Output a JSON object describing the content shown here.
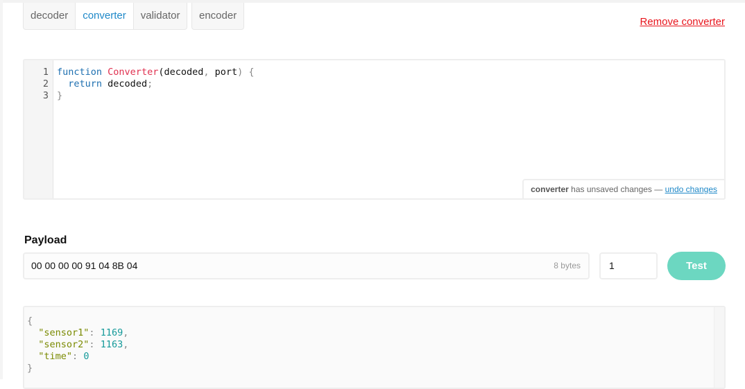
{
  "tabs": [
    {
      "label": "decoder",
      "active": false
    },
    {
      "label": "converter",
      "active": true
    },
    {
      "label": "validator",
      "active": false
    }
  ],
  "tabs2": [
    {
      "label": "encoder"
    }
  ],
  "remove_label": "Remove converter",
  "editor": {
    "line_numbers": [
      "1",
      "2",
      "3"
    ],
    "lines": [
      [
        {
          "t": "function",
          "c": "kw"
        },
        {
          "t": " ",
          "c": ""
        },
        {
          "t": "Converter",
          "c": "fn"
        },
        {
          "t": "(decoded",
          "c": ""
        },
        {
          "t": ",",
          "c": "pn"
        },
        {
          "t": " port",
          "c": ""
        },
        {
          "t": ")",
          "c": "pn"
        },
        {
          "t": " {",
          "c": "pn"
        }
      ],
      [
        {
          "t": "  ",
          "c": ""
        },
        {
          "t": "return",
          "c": "kw"
        },
        {
          "t": " decoded",
          "c": ""
        },
        {
          "t": ";",
          "c": "pn"
        }
      ],
      [
        {
          "t": "}",
          "c": "pn"
        }
      ]
    ],
    "status": {
      "name": "converter",
      "text": " has unsaved changes — ",
      "undo": "undo changes"
    }
  },
  "payload": {
    "label": "Payload",
    "value": "00 00 00 00 91 04 8B 04",
    "bytes": "8 bytes",
    "port": "1",
    "test_label": "Test"
  },
  "output": {
    "open": "{",
    "close": "}",
    "entries": [
      {
        "key": "\"sensor1\"",
        "value": "1169",
        "comma": ","
      },
      {
        "key": "\"sensor2\"",
        "value": "1163",
        "comma": ","
      },
      {
        "key": "\"time\"",
        "value": "0",
        "comma": ""
      }
    ]
  },
  "colors": {
    "accent": "#1e88c8",
    "danger": "#e8141c",
    "test_button": "#6cd7c1"
  }
}
